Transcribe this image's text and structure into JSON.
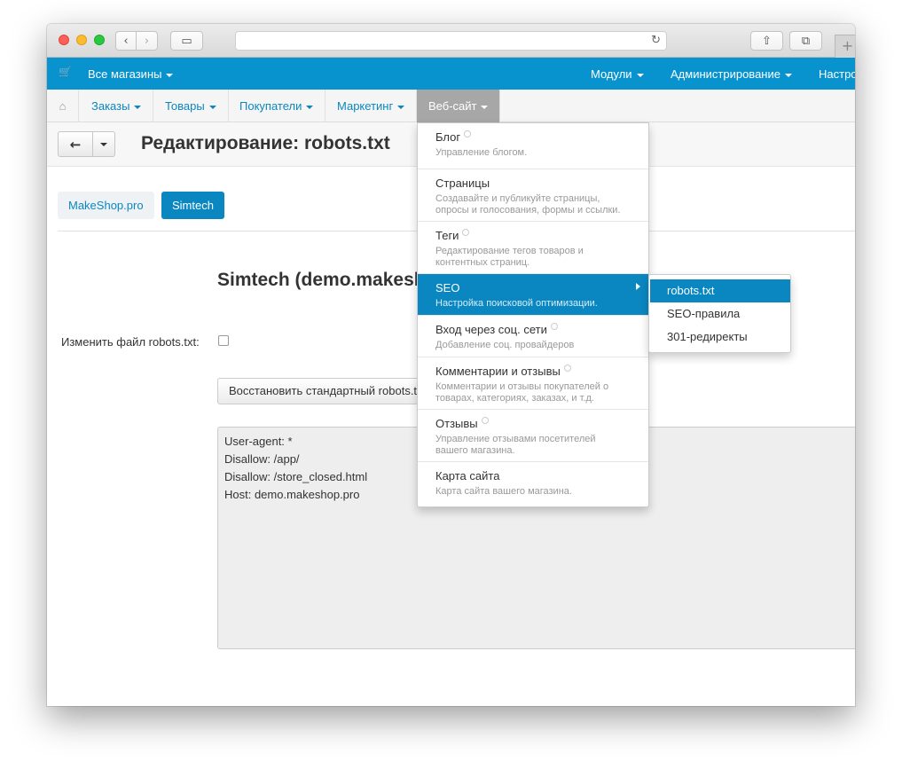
{
  "browser": {
    "nav_back_icon": "‹",
    "nav_forward_icon": "›",
    "sidebar_icon": "▭",
    "reload_icon": "↻",
    "share_icon": "⇧",
    "tabs_icon": "⧉",
    "new_tab_icon": "+"
  },
  "topbar": {
    "cart_icon": "🛒",
    "stores_label": "Все магазины",
    "modules_label": "Модули",
    "admin_label": "Администрирование",
    "settings_label": "Настройки"
  },
  "mainnav": {
    "home_icon": "⌂",
    "items": [
      {
        "label": "Заказы"
      },
      {
        "label": "Товары"
      },
      {
        "label": "Покупатели"
      },
      {
        "label": "Маркетинг"
      },
      {
        "label": "Веб-сайт"
      }
    ]
  },
  "page": {
    "back_icon": "←",
    "title": "Редактирование: robots.txt",
    "stores": [
      {
        "label": "MakeShop.pro"
      },
      {
        "label": "Simtech"
      }
    ],
    "section_title": "Simtech (demo.makeshop.pro)",
    "edit_label": "Изменить файл robots.txt:",
    "restore_label": "Восстановить стандартный robots.txt",
    "robots_lines": [
      "User-agent: *",
      "Disallow: /app/",
      "Disallow: /store_closed.html",
      "Host: demo.makeshop.pro"
    ]
  },
  "dropdown": {
    "items": [
      {
        "title": "Блог",
        "desc": "Управление блогом."
      },
      {
        "title": "Страницы",
        "desc": "Создавайте и публикуйте страницы, опросы и голосования, формы и ссылки."
      },
      {
        "title": "Теги",
        "desc": "Редактирование тегов товаров и контентных страниц."
      },
      {
        "title": "SEO",
        "desc": "Настройка поисковой оптимизации."
      },
      {
        "title": "Вход через соц. сети",
        "desc": "Добавление соц. провайдеров"
      },
      {
        "title": "Комментарии и отзывы",
        "desc": "Комментарии и отзывы покупателей о товарах, категориях, заказах, и т.д."
      },
      {
        "title": "Отзывы",
        "desc": "Управление отзывами посетителей вашего магазина."
      },
      {
        "title": "Карта сайта",
        "desc": "Карта сайта вашего магазина."
      }
    ]
  },
  "submenu": {
    "items": [
      {
        "label": "robots.txt"
      },
      {
        "label": "SEO-правила"
      },
      {
        "label": "301-редиректы"
      }
    ]
  },
  "colors": {
    "topbar": "#0893cf",
    "accent": "#0a87c1",
    "nav_active": "#a7a7a7"
  }
}
